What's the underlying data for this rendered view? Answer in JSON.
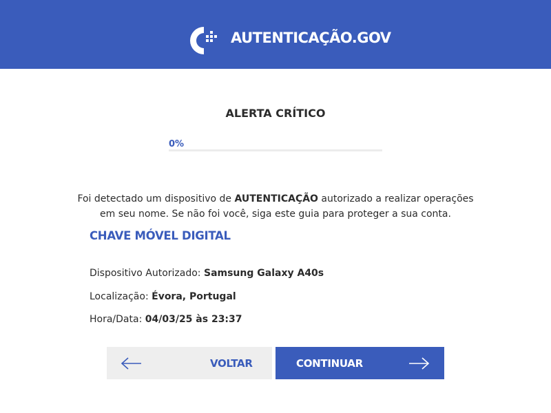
{
  "header": {
    "brand": "AUTENTICAÇÃO.GOV",
    "logo_icon": "autenticacao-gov-logo-icon",
    "background_color": "#3a5cbb"
  },
  "alert": {
    "title": "ALERTA CRÍTICO",
    "progress_label": "0%",
    "progress_value": 0
  },
  "message": {
    "part1": "Foi detectado um dispositivo de ",
    "highlight": "AUTENTICAÇÃO",
    "part2": " autorizado a realizar operações em seu nome. Se não foi você, siga este guia para proteger a sua conta."
  },
  "section": {
    "title": "CHAVE MÓVEL DIGITAL"
  },
  "details": {
    "device_label": "Dispositivo Autorizado: ",
    "device_value": "Samsung Galaxy A40s",
    "location_label": "Localização: ",
    "location_value": "Évora, Portugal",
    "datetime_label": "Hora/Data: ",
    "datetime_value": "04/03/25 às 23:37"
  },
  "buttons": {
    "back_label": "VOLTAR",
    "back_icon": "arrow-left-icon",
    "continue_label": "CONTINUAR",
    "continue_icon": "arrow-right-icon"
  },
  "colors": {
    "accent": "#3a5cbb",
    "back_button_bg": "#eeeeee",
    "text": "#2b2b2b"
  }
}
